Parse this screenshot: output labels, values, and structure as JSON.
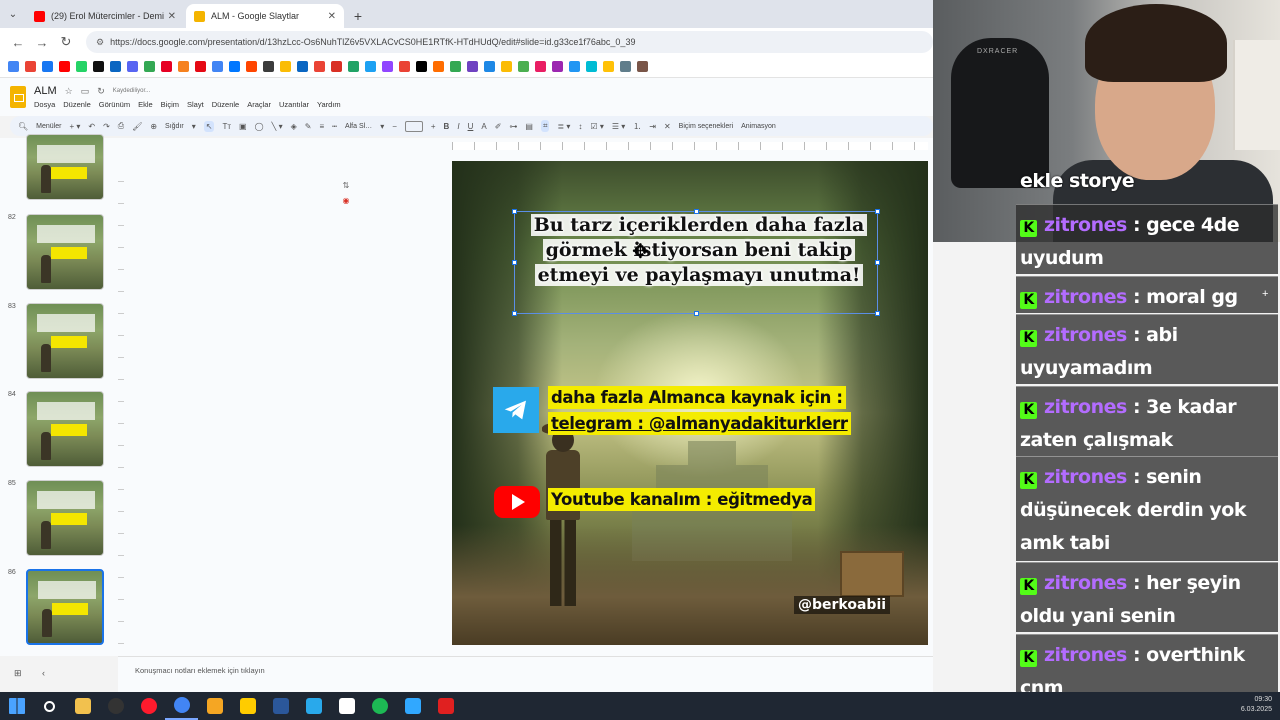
{
  "browser": {
    "tabs": [
      {
        "title": "(29) Erol Mütercimler - Demirt…",
        "favicon_color": "#ff0000",
        "active": false
      },
      {
        "title": "ALM - Google Slaytlar",
        "favicon_color": "#f4b400",
        "active": true
      }
    ],
    "url": "https://docs.google.com/presentation/d/13hzLcc-Os6NuhTlZ6v5VXLACvCS0HE1RTfK-HTdHUdQ/edit#slide=id.g33ce1f76abc_0_39",
    "bookmark_colors": [
      "#4285f4",
      "#ea4335",
      "#1877f2",
      "#ff0000",
      "#25d366",
      "#111111",
      "#0a66c2",
      "#5865f2",
      "#34a853",
      "#e60023",
      "#f6821f",
      "#e50914",
      "#4285f4",
      "#0077ff",
      "#ff4500",
      "#3c3c3c",
      "#fbbc05",
      "#0a66c2",
      "#ea4335",
      "#d93025",
      "#21a366",
      "#1da1f2",
      "#9146ff",
      "#ea4335",
      "#000000",
      "#ff6d00",
      "#34a853",
      "#6f42c1",
      "#1e88e5",
      "#fbbc05",
      "#4caf50",
      "#e91e63",
      "#9c27b0",
      "#2196f3",
      "#00bcd4",
      "#ffc107",
      "#607d8b",
      "#795548"
    ]
  },
  "docs": {
    "title": "ALM",
    "saving": "Kaydediliyor...",
    "menu": [
      "Dosya",
      "Düzenle",
      "Görünüm",
      "Ekle",
      "Biçim",
      "Slayt",
      "Düzenle",
      "Araçlar",
      "Uzantılar",
      "Yardım"
    ],
    "toolbar": {
      "menus": "Menüler",
      "zoom": "Sığdır",
      "font": "Alfa Sl…",
      "format_options": "Biçim seçenekleri",
      "animate": "Animasyon"
    }
  },
  "filmstrip": {
    "slides": [
      {
        "num": "",
        "current": false
      },
      {
        "num": "82",
        "current": false
      },
      {
        "num": "83",
        "current": false
      },
      {
        "num": "84",
        "current": false
      },
      {
        "num": "85",
        "current": false
      },
      {
        "num": "86",
        "current": true
      }
    ]
  },
  "slide": {
    "headline_lines": [
      "Bu tarz içeriklerden daha fazla",
      "görmek istiyorsan beni takip",
      "etmeyi ve paylaşmayı unutma!"
    ],
    "telegram_line1": "daha fazla Almanca kaynak için :",
    "telegram_line2": "telegram : @almanyadakiturklerr",
    "youtube_line": "Youtube kanalım : eğitmedya",
    "handle": "@berkoabii"
  },
  "notes_placeholder": "Konuşmacı notları eklemek için tıklayın",
  "chat": {
    "first_line": "ekle storye",
    "messages": [
      {
        "user": "zitrones",
        "text": "gece 4de uyudum"
      },
      {
        "user": "zitrones",
        "text": "moral gg"
      },
      {
        "user": "zitrones",
        "text": "abi uyuyamadım"
      },
      {
        "user": "zitrones",
        "text": "3e kadar zaten çalışmak"
      },
      {
        "user": "zitrones",
        "text": "senin düşünecek derdin yok amk tabi"
      },
      {
        "user": "zitrones",
        "text": "her şeyin oldu yani senin"
      },
      {
        "user": "zitrones",
        "text": "overthink cnm"
      }
    ],
    "badge": "K",
    "separator": ":"
  },
  "webcam": {
    "chair_brand": "DXRACER"
  },
  "taskbar": {
    "apps": [
      "windows-start",
      "search",
      "file-explorer",
      "obs",
      "opera",
      "chrome",
      "fl-studio",
      "yandex",
      "word",
      "telegram",
      "capcut",
      "spotify",
      "photoshop",
      "acrobat"
    ],
    "app_colors": [
      "#4aa3ff",
      "#ffffff",
      "#f2c14e",
      "#333333",
      "#ff1b2d",
      "#4285f4",
      "#f5a623",
      "#ffcc00",
      "#2b579a",
      "#29a9eb",
      "#ffffff",
      "#1db954",
      "#31a8ff",
      "#e02020"
    ],
    "time": "09:30",
    "date": "6.03.2025"
  }
}
